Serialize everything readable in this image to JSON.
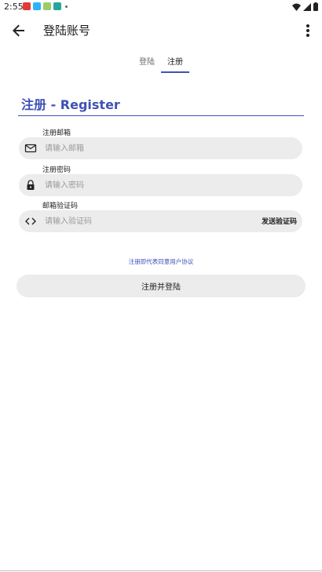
{
  "status_bar": {
    "time": "2:55"
  },
  "app_bar": {
    "title": "登陆账号"
  },
  "tabs": [
    {
      "label": "登陆",
      "selected": false
    },
    {
      "label": "注册",
      "selected": true
    }
  ],
  "form": {
    "heading": "注册 - Register",
    "email": {
      "label": "注册邮箱",
      "placeholder": "请输入邮箱",
      "value": "",
      "icon": "mail-icon"
    },
    "password": {
      "label": "注册密码",
      "placeholder": "请输入密码",
      "value": "",
      "icon": "lock-icon"
    },
    "code": {
      "label": "邮箱验证码",
      "placeholder": "请输入验证码",
      "value": "",
      "icon": "code-icon",
      "send_label": "发送验证码"
    },
    "agreement": "注册即代表同意用户协议",
    "submit_label": "注册并登陆"
  },
  "colors": {
    "accent": "#3f51b5",
    "field_bg": "#ececec"
  }
}
